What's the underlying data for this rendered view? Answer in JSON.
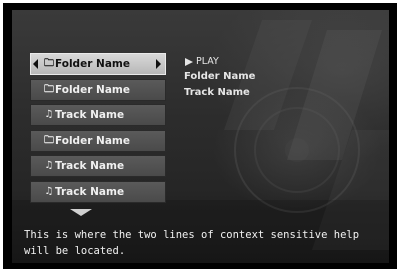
{
  "menu": {
    "items": [
      {
        "icon": "folder-icon",
        "glyph": "🗀",
        "label": "Folder Name",
        "selected": true
      },
      {
        "icon": "folder-icon",
        "glyph": "🗀",
        "label": "Folder Name",
        "selected": false
      },
      {
        "icon": "music-note-icon",
        "glyph": "♫",
        "label": "Track Name",
        "selected": false
      },
      {
        "icon": "folder-icon",
        "glyph": "🗀",
        "label": "Folder Name",
        "selected": false
      },
      {
        "icon": "music-note-icon",
        "glyph": "♫",
        "label": "Track Name",
        "selected": false
      },
      {
        "icon": "music-note-icon",
        "glyph": "♫",
        "label": "Track Name",
        "selected": false
      }
    ]
  },
  "info": {
    "play_label": "PLAY",
    "folder_name": "Folder Name",
    "track_name": "Track Name"
  },
  "help": {
    "text": "This is where the two lines of context sensitive help will be located."
  },
  "colors": {
    "selected_bg": "#c8c8c8",
    "item_bg": "#505050",
    "text": "#f0f0f0"
  }
}
